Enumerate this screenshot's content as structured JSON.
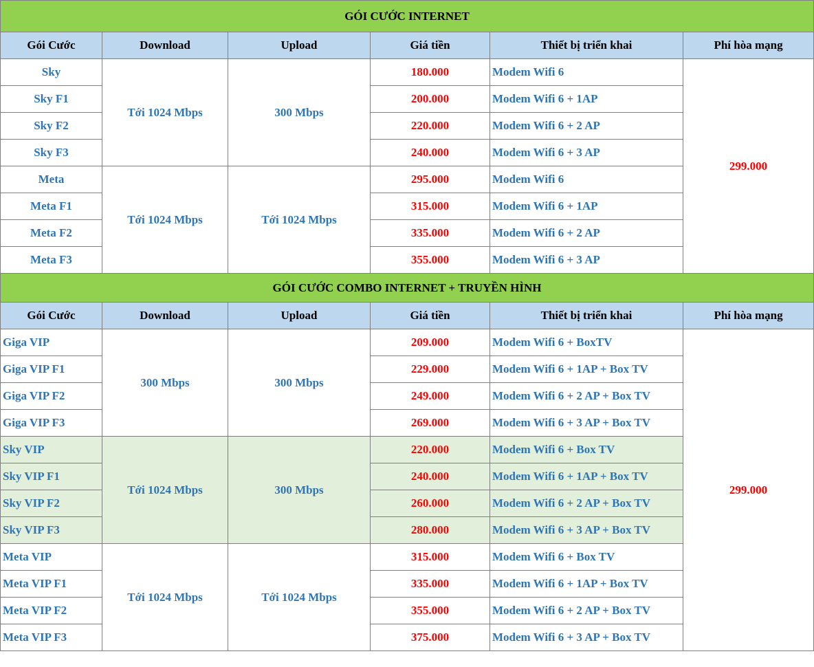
{
  "colors": {
    "title_bg": "#92d050",
    "header_bg": "#bdd7ee",
    "text_blue": "#2e75b6",
    "price_red": "#ff0000",
    "shaded_bg": "#e2efda"
  },
  "columns": [
    "Gói Cước",
    "Download",
    "Upload",
    "Giá tiền",
    "Thiết bị triển khai",
    "Phí hòa mạng"
  ],
  "section1": {
    "title": "GÓI CƯỚC INTERNET",
    "fee": "299.000",
    "groups": [
      {
        "download": "Tới 1024 Mbps",
        "upload": "300 Mbps",
        "rows": [
          {
            "name": "Sky",
            "price": "180.000",
            "device": "Modem Wifi 6"
          },
          {
            "name": "Sky F1",
            "price": "200.000",
            "device": "Modem Wifi 6 + 1AP"
          },
          {
            "name": "Sky F2",
            "price": "220.000",
            "device": "Modem Wifi 6 + 2 AP"
          },
          {
            "name": "Sky F3",
            "price": "240.000",
            "device": "Modem Wifi 6 + 3 AP"
          }
        ]
      },
      {
        "download": "Tới 1024 Mbps",
        "upload": "Tới 1024 Mbps",
        "rows": [
          {
            "name": "Meta",
            "price": "295.000",
            "device": "Modem Wifi 6"
          },
          {
            "name": "Meta F1",
            "price": "315.000",
            "device": "Modem Wifi 6 + 1AP"
          },
          {
            "name": "Meta F2",
            "price": "335.000",
            "device": "Modem Wifi 6 + 2 AP"
          },
          {
            "name": "Meta F3",
            "price": "355.000",
            "device": "Modem Wifi 6 + 3 AP"
          }
        ]
      }
    ]
  },
  "section2": {
    "title": "GÓI CƯỚC COMBO INTERNET  + TRUYỀN HÌNH",
    "fee": "299.000",
    "groups": [
      {
        "download": "300 Mbps",
        "upload": "300 Mbps",
        "rows": [
          {
            "name": "Giga VIP",
            "price": "209.000",
            "device": "Modem Wifi 6 + BoxTV"
          },
          {
            "name": "Giga VIP F1",
            "price": "229.000",
            "device": "Modem Wifi 6 + 1AP + Box TV"
          },
          {
            "name": "Giga VIP F2",
            "price": "249.000",
            "device": "Modem Wifi 6 + 2 AP + Box TV"
          },
          {
            "name": "Giga VIP F3",
            "price": "269.000",
            "device": "Modem Wifi 6 + 3 AP + Box TV"
          }
        ]
      },
      {
        "download": "Tới 1024 Mbps",
        "upload": "300 Mbps",
        "rows": [
          {
            "name": "Sky VIP",
            "price": "220.000",
            "device": "Modem Wifi 6 + Box TV"
          },
          {
            "name": "Sky VIP F1",
            "price": "240.000",
            "device": "Modem Wifi 6 + 1AP + Box TV"
          },
          {
            "name": "Sky VIP F2",
            "price": "260.000",
            "device": "Modem Wifi 6 + 2 AP + Box TV"
          },
          {
            "name": "Sky VIP F3",
            "price": "280.000",
            "device": "Modem Wifi 6 + 3 AP + Box TV"
          }
        ]
      },
      {
        "download": "Tới 1024 Mbps",
        "upload": "Tới 1024 Mbps",
        "rows": [
          {
            "name": "Meta VIP",
            "price": "315.000",
            "device": "Modem Wifi 6 + Box TV"
          },
          {
            "name": "Meta VIP F1",
            "price": "335.000",
            "device": "Modem Wifi 6 + 1AP + Box TV"
          },
          {
            "name": "Meta VIP F2",
            "price": "355.000",
            "device": "Modem Wifi 6 + 2 AP + Box TV"
          },
          {
            "name": "Meta VIP F3",
            "price": "375.000",
            "device": "Modem Wifi 6 + 3 AP + Box TV"
          }
        ]
      }
    ]
  }
}
